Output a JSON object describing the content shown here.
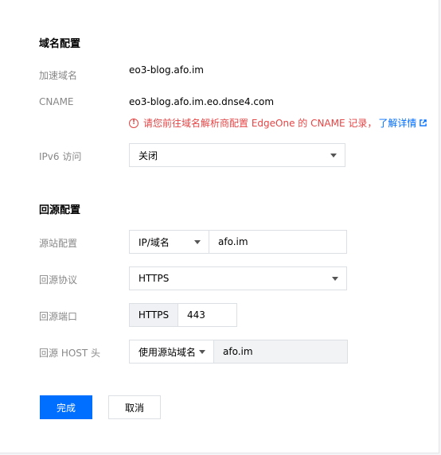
{
  "domain_section": {
    "title": "域名配置",
    "accel_domain_label": "加速域名",
    "accel_domain_value": "eo3-blog.afo.im",
    "cname_label": "CNAME",
    "cname_value": "eo3-blog.afo.im.eo.dnse4.com",
    "warning_text": "请您前往域名解析商配置 EdgeOne 的 CNAME 记录，",
    "warning_link": "了解详情",
    "ipv6_label": "IPv6 访问",
    "ipv6_value": "关闭"
  },
  "origin_section": {
    "title": "回源配置",
    "origin_label": "源站配置",
    "origin_type": "IP/域名",
    "origin_value": "afo.im",
    "protocol_label": "回源协议",
    "protocol_value": "HTTPS",
    "port_label": "回源端口",
    "port_addon": "HTTPS",
    "port_value": "443",
    "host_label": "回源 HOST 头",
    "host_type": "使用源站域名",
    "host_value": "afo.im"
  },
  "actions": {
    "confirm_label": "完成",
    "cancel_label": "取消"
  },
  "colors": {
    "primary": "#006eff",
    "warning": "#e54545"
  },
  "icons": {
    "warning": "exclamation-circle-icon",
    "external_link": "external-link-icon",
    "dropdown": "chevron-down-icon"
  }
}
